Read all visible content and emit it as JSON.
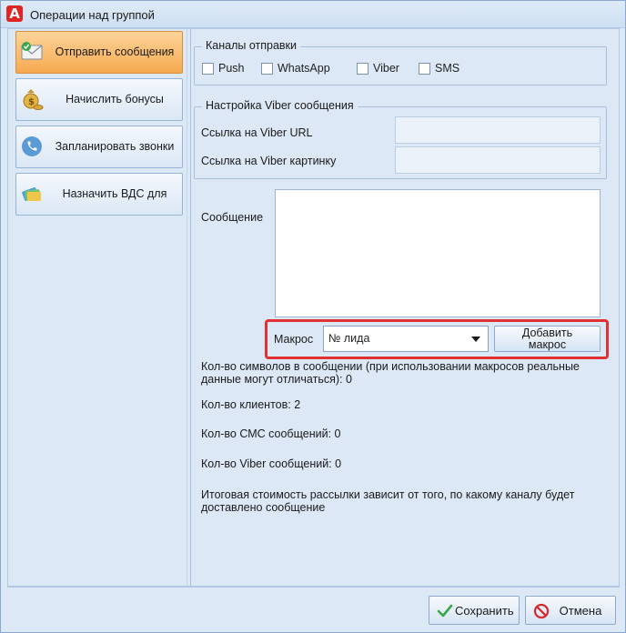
{
  "window": {
    "title": "Операции над группой"
  },
  "nav": {
    "items": [
      {
        "label": "Отправить сообщения",
        "icon": "envelope-icon",
        "active": true
      },
      {
        "label": "Начислить бонусы",
        "icon": "money-bag-icon",
        "active": false
      },
      {
        "label": "Запланировать звонки",
        "icon": "phone-icon",
        "active": false
      },
      {
        "label": "Назначить ВДС для",
        "icon": "cards-icon",
        "active": false
      }
    ]
  },
  "channels": {
    "legend": "Каналы отправки",
    "options": [
      {
        "label": "Push",
        "checked": false
      },
      {
        "label": "WhatsApp",
        "checked": false
      },
      {
        "label": "Viber",
        "checked": false
      },
      {
        "label": "SMS",
        "checked": false
      }
    ]
  },
  "viber": {
    "legend": "Настройка Viber сообщения",
    "url_label": "Ссылка на Viber URL",
    "url_value": "",
    "image_label": "Ссылка на Viber картинку",
    "image_value": ""
  },
  "message": {
    "label": "Сообщение",
    "value": ""
  },
  "macro": {
    "label": "Макрос",
    "selected": "№ лида",
    "add_button_line1": "Добавить",
    "add_button_line2": "макрос",
    "highlight_color": "#e03232"
  },
  "stats": {
    "chars_line1": "Кол-во символов в сообщении (при использовании макросов реальные",
    "chars_line2": "данные могут отличаться): 0",
    "clients": "Кол-во клиентов: 2",
    "sms": "Кол-во СМС сообщений: 0",
    "viber": "Кол-во Viber сообщений: 0",
    "cost_line1": "Итоговая стоимость рассылки зависит от того, по какому каналу будет",
    "cost_line2": "доставлено сообщение"
  },
  "footer": {
    "save_label": "Сохранить",
    "cancel_label": "Отмена"
  }
}
